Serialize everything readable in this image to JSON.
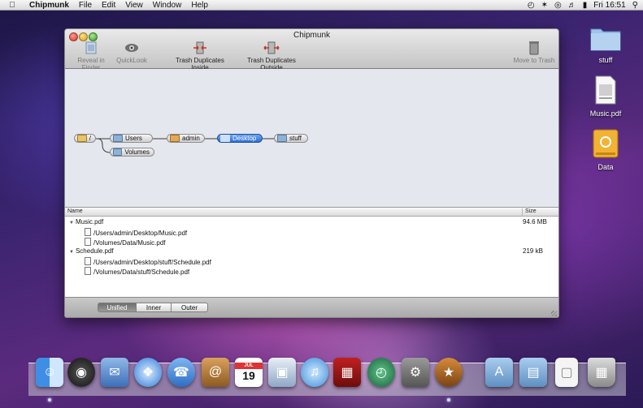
{
  "menubar": {
    "apple": "",
    "app_name": "Chipmunk",
    "menus": [
      "File",
      "Edit",
      "View",
      "Window",
      "Help"
    ],
    "clock": "Fri 16:51"
  },
  "window": {
    "title": "Chipmunk",
    "toolbar": {
      "reveal": "Reveal in Finder",
      "quicklook": "QuickLook",
      "trash_inside": "Trash Duplicates Inside",
      "trash_outside": "Trash Duplicates Outside",
      "move_trash": "Move to Trash"
    },
    "tree": {
      "root": "/",
      "users": "Users",
      "volumes": "Volumes",
      "admin": "admin",
      "desktop": "Desktop",
      "stuff": "stuff"
    },
    "list": {
      "col_name": "Name",
      "col_size": "Size",
      "rows": [
        {
          "name": "Music.pdf",
          "size": "94.6 MB"
        },
        {
          "name": "/Users/admin/Desktop/Music.pdf"
        },
        {
          "name": "/Volumes/Data/Music.pdf"
        },
        {
          "name": "Schedule.pdf",
          "size": "219 kB"
        },
        {
          "name": "/Users/admin/Desktop/stuff/Schedule.pdf"
        },
        {
          "name": "/Volumes/Data/stuff/Schedule.pdf"
        }
      ]
    },
    "segments": {
      "unified": "Unified",
      "inner": "Inner",
      "outer": "Outer",
      "selected": "Unified"
    }
  },
  "desktop": {
    "items": [
      "stuff",
      "Music.pdf",
      "Data"
    ]
  },
  "dock": {
    "apps": [
      "Finder",
      "Dashboard",
      "Mail",
      "Safari",
      "iChat",
      "Address Book",
      "iCal",
      "Preview",
      "iTunes",
      "Photo Booth",
      "Time Machine",
      "System Preferences",
      "Chipmunk",
      "Applications",
      "Documents",
      "Document",
      "Trash"
    ],
    "ical_day": "19",
    "ical_month": "JUL"
  },
  "colors": {
    "selected_node": "#2d6fd2",
    "segment_on": "#7a7a7a"
  }
}
